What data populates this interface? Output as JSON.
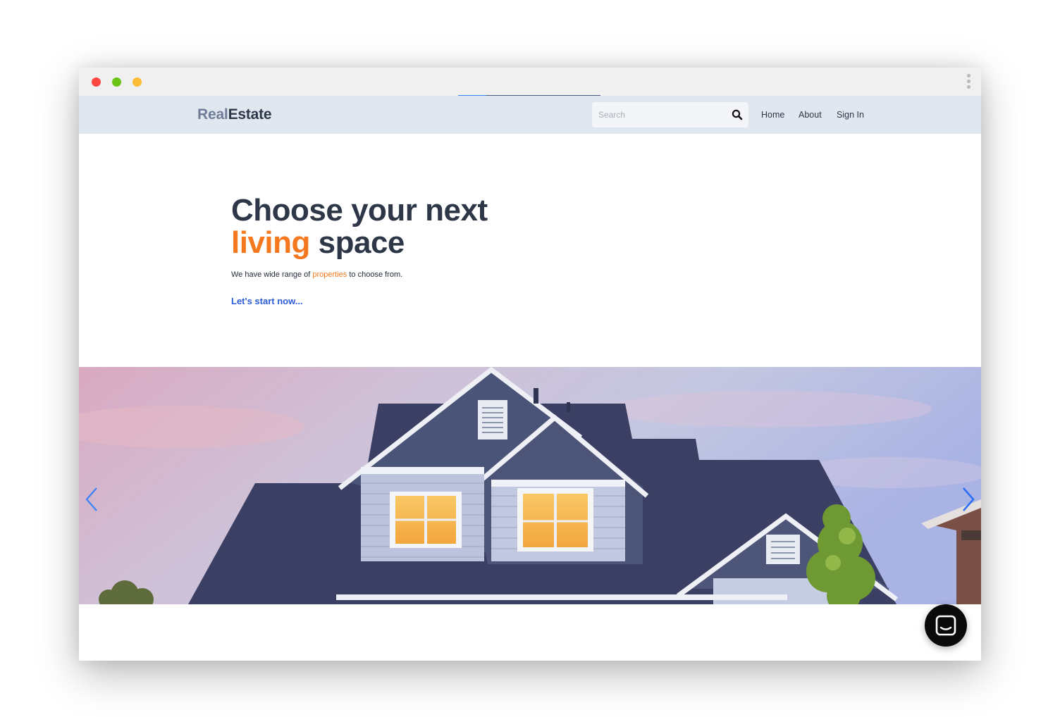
{
  "window": {
    "controls": [
      "close",
      "minimize",
      "maximize"
    ],
    "menu_icon": "kebab-menu-icon"
  },
  "navbar": {
    "brand_part1": "Real",
    "brand_part2": "Estate",
    "search_placeholder": "Search",
    "search_icon": "magnifier-icon",
    "links": [
      "Home",
      "About",
      "Sign In"
    ]
  },
  "hero": {
    "title_line1": "Choose your next",
    "title_accent": "living",
    "title_rest": "space",
    "subtitle_before": "We have wide range of",
    "subtitle_accent": "properties",
    "subtitle_after": "to choose from.",
    "cta": "Let's start now..."
  },
  "carousel": {
    "image": "house-photo",
    "prev_icon": "chevron-left-icon",
    "next_icon": "chevron-right-icon"
  },
  "chat": {
    "icon": "chat-icon"
  },
  "colors": {
    "accent_orange": "#f5781e",
    "link_blue": "#2b5bd7",
    "text_dark": "#2d3748",
    "brand_muted": "#6f7d99",
    "navbar_bg": "#e1e7ef"
  }
}
